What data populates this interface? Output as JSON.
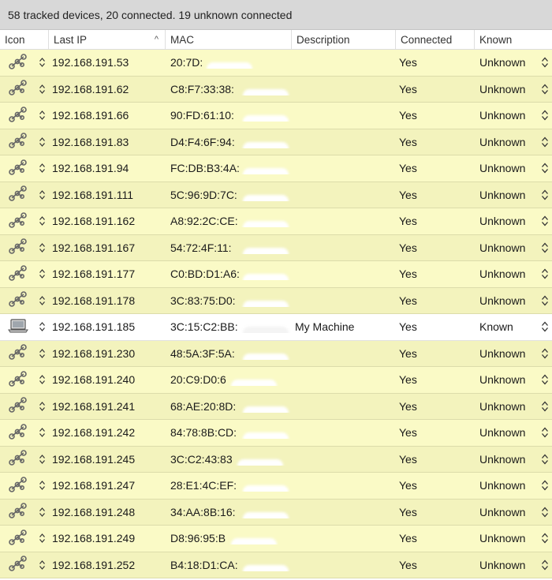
{
  "status": {
    "text": "58 tracked devices, 20 connected. 19 unknown connected"
  },
  "columns": {
    "icon": "Icon",
    "last_ip": "Last IP",
    "mac": "MAC",
    "description": "Description",
    "connected": "Connected",
    "known": "Known"
  },
  "sort": {
    "column": "last_ip",
    "direction": "ascending",
    "indicator": "^"
  },
  "icons": {
    "unknown_device": "network-nodes-icon",
    "known_device": "laptop-icon",
    "stepper": "up-down-stepper-icon"
  },
  "colors": {
    "unknown_row": "#fafac6",
    "unknown_row_alt": "#f3f3bd",
    "known_row": "#ffffff",
    "status_bar": "#d8d8d8"
  },
  "rows": [
    {
      "ip": "192.168.191.53",
      "mac": "20:7D:",
      "description": "",
      "connected": "Yes",
      "known": "Unknown",
      "type": "unknown"
    },
    {
      "ip": "192.168.191.62",
      "mac": "C8:F7:33:38:",
      "description": "",
      "connected": "Yes",
      "known": "Unknown",
      "type": "unknown"
    },
    {
      "ip": "192.168.191.66",
      "mac": "90:FD:61:10:",
      "description": "",
      "connected": "Yes",
      "known": "Unknown",
      "type": "unknown"
    },
    {
      "ip": "192.168.191.83",
      "mac": "D4:F4:6F:94:",
      "description": "",
      "connected": "Yes",
      "known": "Unknown",
      "type": "unknown"
    },
    {
      "ip": "192.168.191.94",
      "mac": "FC:DB:B3:4A:",
      "description": "",
      "connected": "Yes",
      "known": "Unknown",
      "type": "unknown"
    },
    {
      "ip": "192.168.191.111",
      "mac": "5C:96:9D:7C:",
      "description": "",
      "connected": "Yes",
      "known": "Unknown",
      "type": "unknown"
    },
    {
      "ip": "192.168.191.162",
      "mac": "A8:92:2C:CE:",
      "description": "",
      "connected": "Yes",
      "known": "Unknown",
      "type": "unknown"
    },
    {
      "ip": "192.168.191.167",
      "mac": "54:72:4F:11:",
      "description": "",
      "connected": "Yes",
      "known": "Unknown",
      "type": "unknown"
    },
    {
      "ip": "192.168.191.177",
      "mac": "C0:BD:D1:A6:",
      "description": "",
      "connected": "Yes",
      "known": "Unknown",
      "type": "unknown"
    },
    {
      "ip": "192.168.191.178",
      "mac": "3C:83:75:D0:",
      "description": "",
      "connected": "Yes",
      "known": "Unknown",
      "type": "unknown"
    },
    {
      "ip": "192.168.191.185",
      "mac": "3C:15:C2:BB:",
      "description": "My Machine",
      "connected": "Yes",
      "known": "Known",
      "type": "known"
    },
    {
      "ip": "192.168.191.230",
      "mac": "48:5A:3F:5A:",
      "description": "",
      "connected": "Yes",
      "known": "Unknown",
      "type": "unknown"
    },
    {
      "ip": "192.168.191.240",
      "mac": "20:C9:D0:6",
      "description": "",
      "connected": "Yes",
      "known": "Unknown",
      "type": "unknown"
    },
    {
      "ip": "192.168.191.241",
      "mac": "68:AE:20:8D:",
      "description": "",
      "connected": "Yes",
      "known": "Unknown",
      "type": "unknown"
    },
    {
      "ip": "192.168.191.242",
      "mac": "84:78:8B:CD:",
      "description": "",
      "connected": "Yes",
      "known": "Unknown",
      "type": "unknown"
    },
    {
      "ip": "192.168.191.245",
      "mac": "3C:C2:43:83",
      "description": "",
      "connected": "Yes",
      "known": "Unknown",
      "type": "unknown"
    },
    {
      "ip": "192.168.191.247",
      "mac": "28:E1:4C:EF:",
      "description": "",
      "connected": "Yes",
      "known": "Unknown",
      "type": "unknown"
    },
    {
      "ip": "192.168.191.248",
      "mac": "34:AA:8B:16:",
      "description": "",
      "connected": "Yes",
      "known": "Unknown",
      "type": "unknown"
    },
    {
      "ip": "192.168.191.249",
      "mac": "D8:96:95:B",
      "description": "",
      "connected": "Yes",
      "known": "Unknown",
      "type": "unknown"
    },
    {
      "ip": "192.168.191.252",
      "mac": "B4:18:D1:CA:",
      "description": "",
      "connected": "Yes",
      "known": "Unknown",
      "type": "unknown"
    }
  ]
}
